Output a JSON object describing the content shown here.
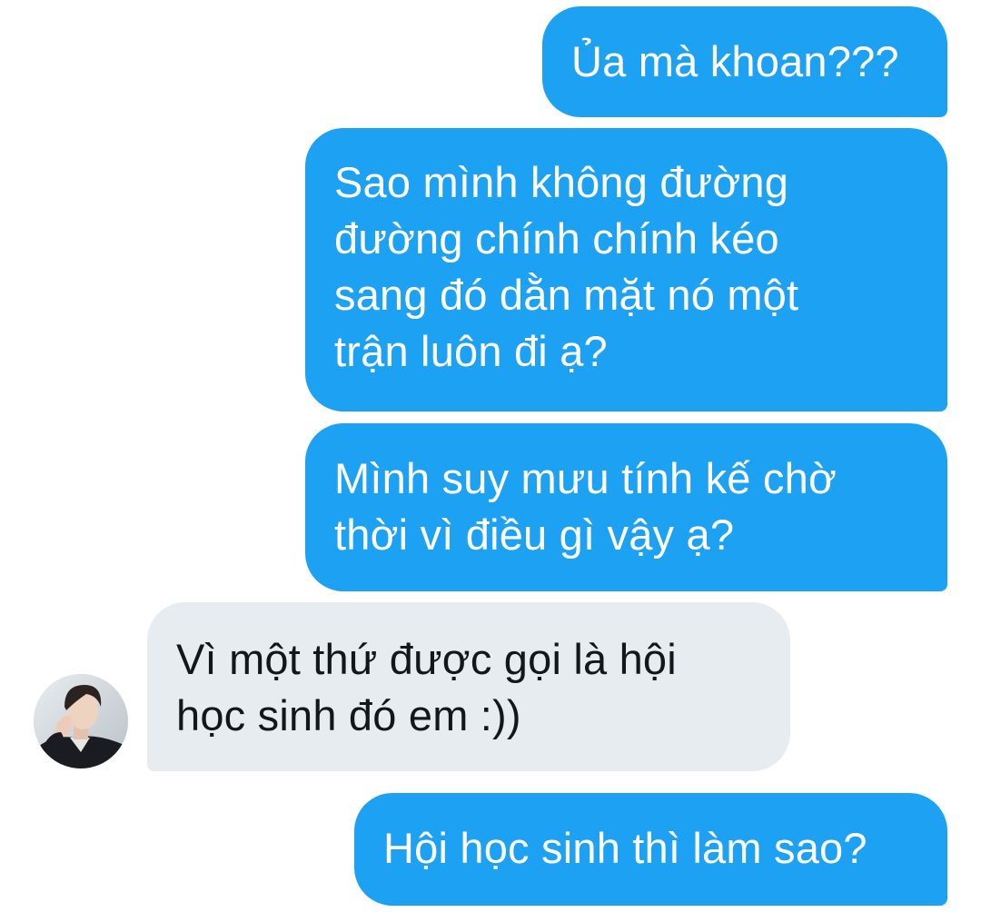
{
  "conversation": {
    "messages": [
      {
        "direction": "outgoing",
        "text": "Ủa mà khoan???"
      },
      {
        "direction": "outgoing",
        "text": "Sao mình không đường\nđường chính chính kéo\nsang đó dằn mặt nó một\ntrận luôn đi ạ?"
      },
      {
        "direction": "outgoing",
        "text": "Mình suy mưu tính kế chờ\nthời vì điều gì vậy ạ?"
      },
      {
        "direction": "incoming",
        "text": "Vì một thứ được gọi là hội\nhọc sinh đó em :))"
      },
      {
        "direction": "outgoing",
        "text": "Hội học sinh thì làm sao?"
      }
    ],
    "contact_avatar": {
      "icon": "contact-avatar-photo"
    }
  },
  "colors": {
    "outgoing_bubble": "#1da1f2",
    "outgoing_text": "#ffffff",
    "incoming_bubble": "#e6ecf0",
    "incoming_text": "#14171a",
    "background": "#ffffff"
  }
}
